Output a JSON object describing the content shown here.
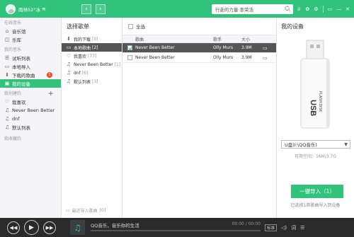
{
  "topbar": {
    "username": "雨林52°冰",
    "wifi_icon": "wifi-icon",
    "back": "‹",
    "forward": "›",
    "search_value": "行走的力量 李荣浩",
    "actions": [
      "反馈",
      "换肤",
      "设置",
      "迷你",
      "最小化",
      "最大化",
      "关闭"
    ],
    "action_glyphs": [
      "反馈",
      "♕",
      "✿",
      "⚙",
      "▭",
      "—",
      "✕"
    ]
  },
  "sidebar": {
    "sections": [
      {
        "label": "在线音乐",
        "items": [
          {
            "label": "音乐馆",
            "icon": "music-hall-icon",
            "glyph": "⌂"
          },
          {
            "label": "乐库",
            "icon": "library-icon",
            "glyph": "◫"
          }
        ]
      },
      {
        "label": "我的音乐",
        "items": [
          {
            "label": "试听列表",
            "icon": "list-icon",
            "glyph": "☰"
          },
          {
            "label": "本地导入",
            "icon": "import-icon",
            "glyph": "▭"
          },
          {
            "label": "下载的歌曲",
            "icon": "download-icon",
            "glyph": "⬇",
            "badge": "1"
          },
          {
            "label": "我的设备",
            "icon": "device-icon",
            "glyph": "▣",
            "active": true
          }
        ]
      },
      {
        "label": "我创建的",
        "items": [
          {
            "label": "我喜欢",
            "icon": "heart-icon",
            "glyph": "♡"
          },
          {
            "label": "Never Been Better",
            "icon": "note-icon",
            "glyph": "♫"
          },
          {
            "label": "dnf",
            "icon": "note-icon",
            "glyph": "♫"
          },
          {
            "label": "默认列表",
            "icon": "note-icon",
            "glyph": "♫"
          }
        ]
      },
      {
        "label": "我收藏的",
        "items": []
      }
    ],
    "add_glyph": "+"
  },
  "playlists": {
    "title": "选择歌单",
    "items": [
      {
        "label": "我的下载",
        "count": "[0]",
        "glyph": "⬇"
      },
      {
        "label": "本地歌曲",
        "count": "[2]",
        "glyph": "▭",
        "active": true
      },
      {
        "label": "我喜欢",
        "count": "[77]",
        "glyph": "♡"
      },
      {
        "label": "Never Been Better",
        "count": "[1]",
        "glyph": "♫"
      },
      {
        "label": "dnf",
        "count": "[6]",
        "glyph": "♫"
      },
      {
        "label": "默认列表",
        "count": "[3]",
        "glyph": "♫"
      }
    ],
    "footer": "最近导入歌曲",
    "footer_count": "[0]"
  },
  "songs": {
    "select_all": "全选",
    "headers": {
      "title": "歌曲",
      "artist": "歌手",
      "size": "大小"
    },
    "rows": [
      {
        "title": "Never Been Better",
        "artist": "Olly Murs",
        "size": "3.9M",
        "checked": true,
        "selected": true
      },
      {
        "title": "Never Been Better",
        "artist": "Olly Murs",
        "size": "3.9M",
        "checked": false,
        "selected": false
      }
    ]
  },
  "device": {
    "title": "我的设备",
    "usb_label": "USB",
    "usb_sub": "FLASH DISK",
    "drive": "U盘(I:\\QQ音乐)",
    "space": "可用空间：16M/3.7G",
    "import_button": "一键导入（1）",
    "hint": "已选择1首歌曲导入到设备"
  },
  "player": {
    "song": "QQ音乐，音乐你的生活",
    "time": "00:00 / 00:00",
    "progress": 0,
    "quality": "标准",
    "controls": [
      "◀◀",
      "▶",
      "▶▶"
    ]
  },
  "colors": {
    "accent": "#31c27c",
    "badge": "#f04a2b",
    "player_bg": "#2a2a2a"
  }
}
